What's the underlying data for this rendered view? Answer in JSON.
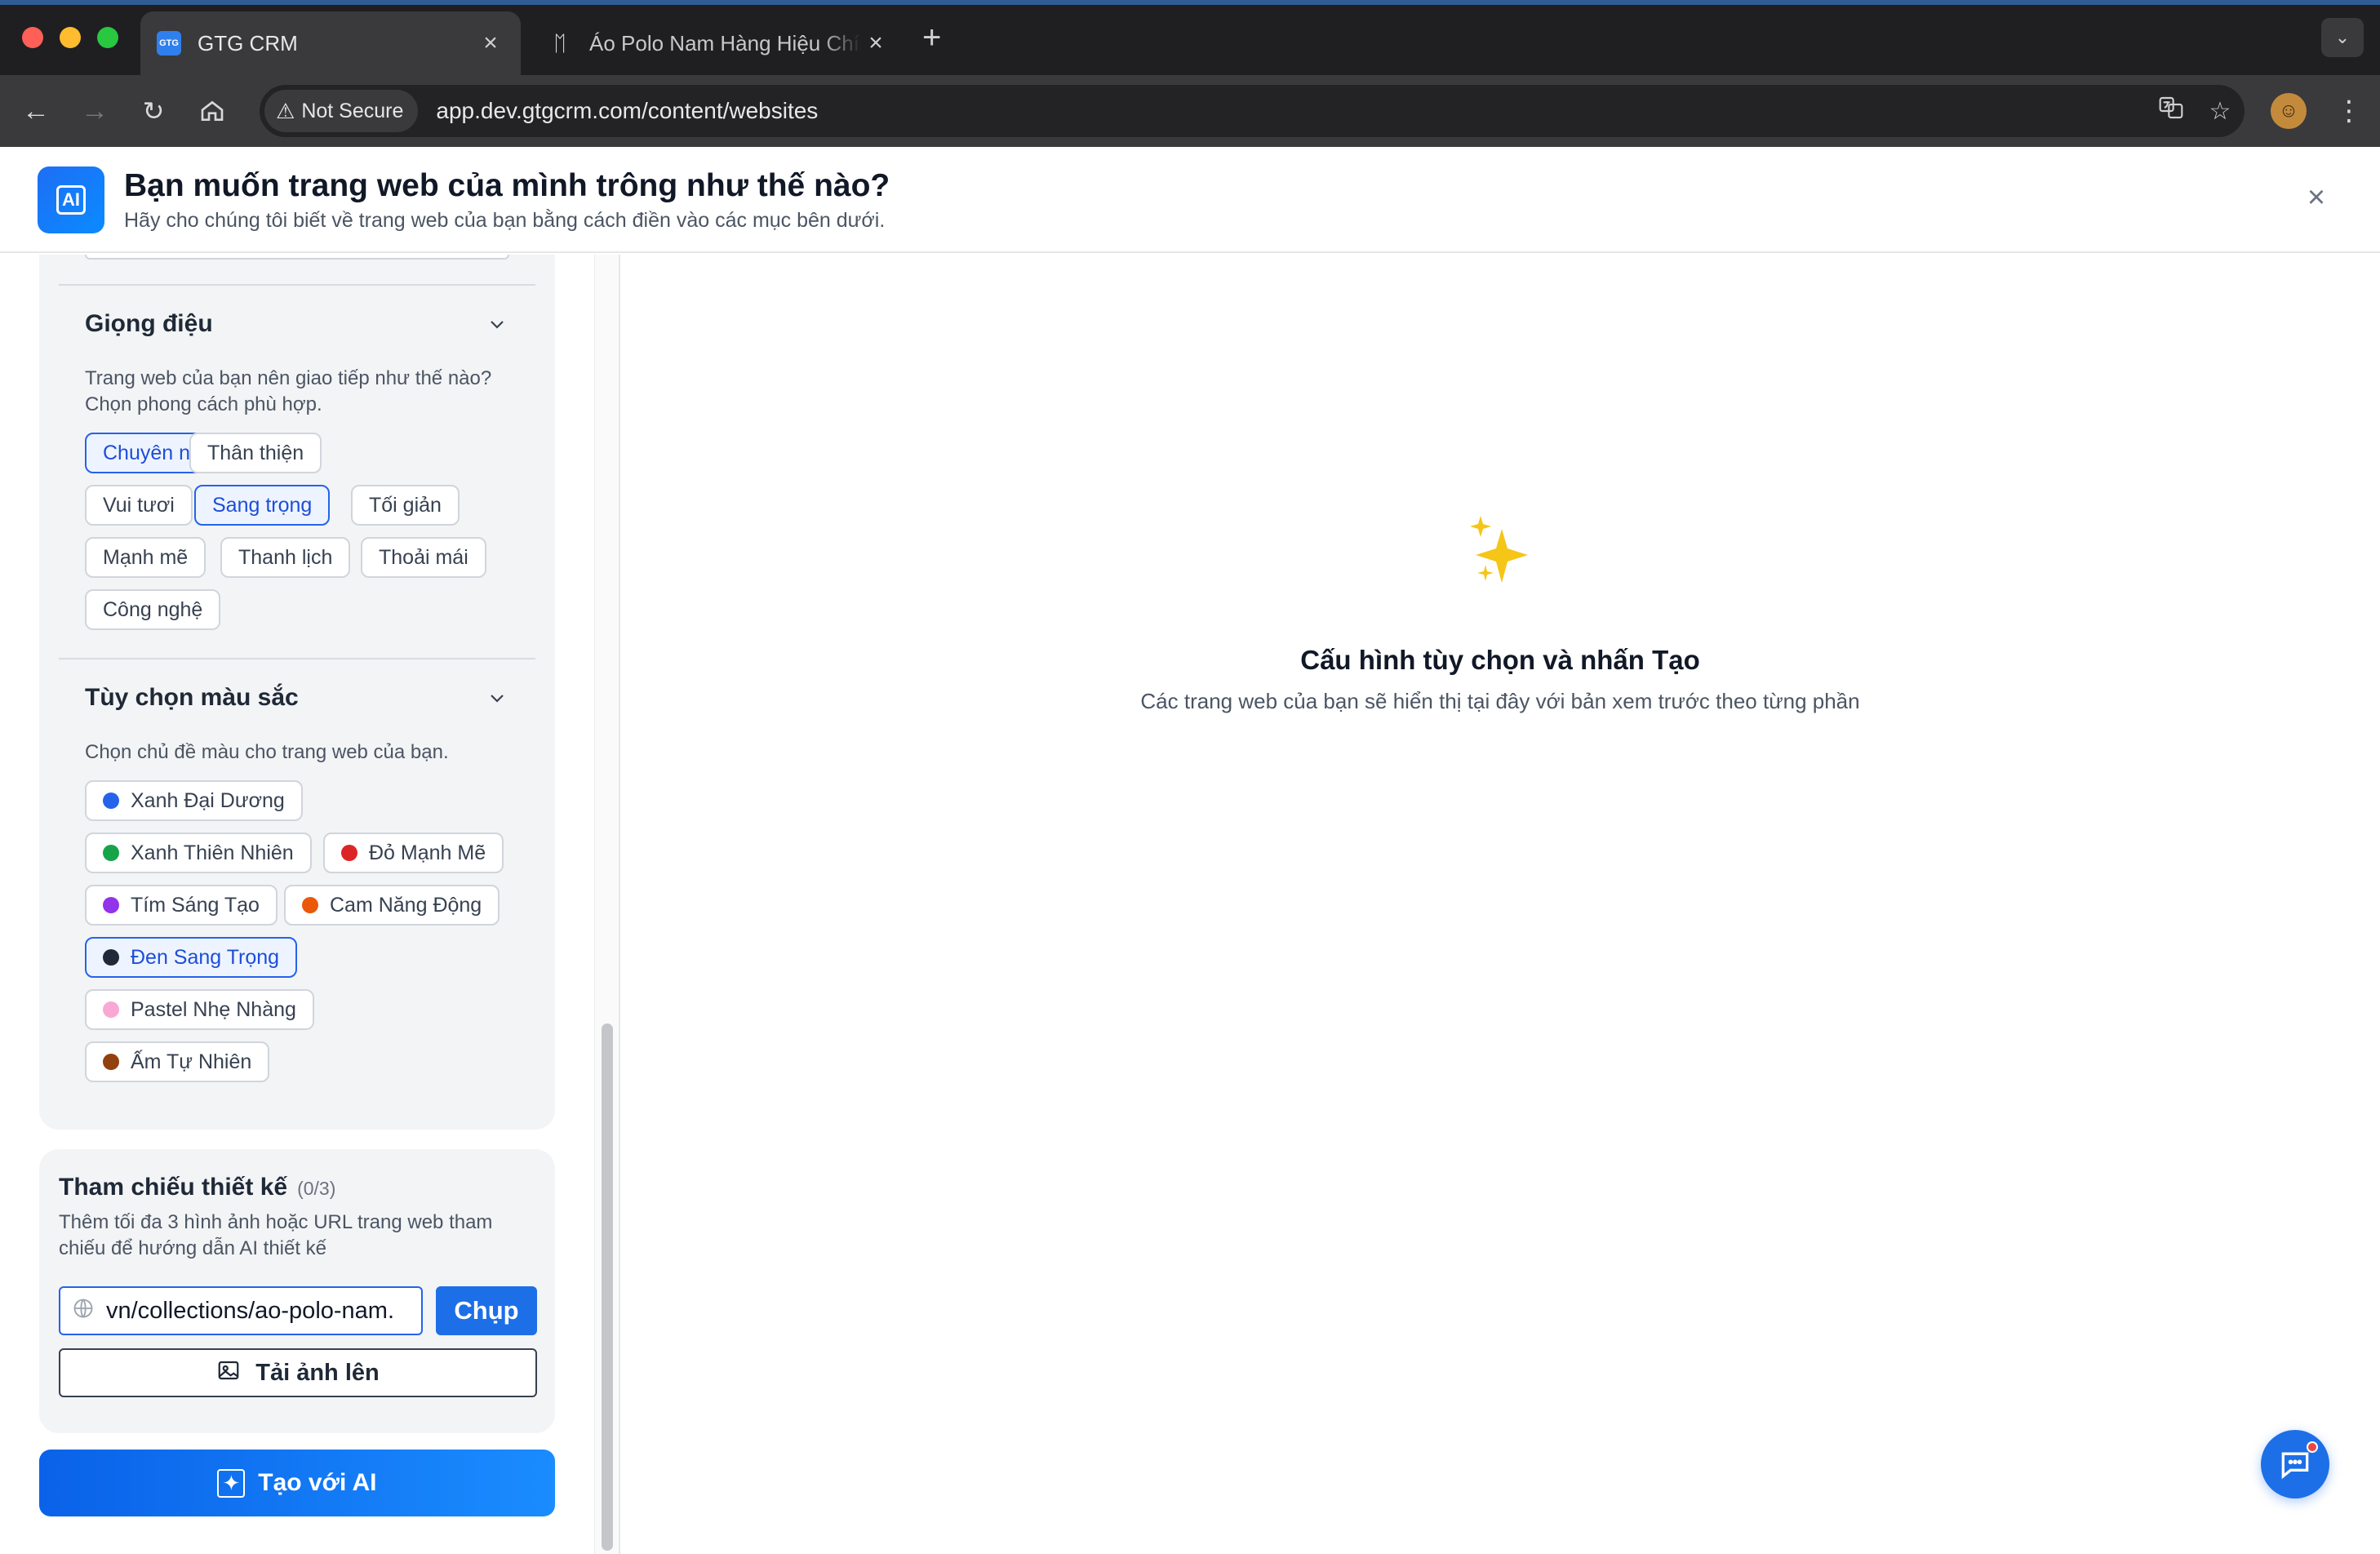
{
  "browser": {
    "tabs": [
      {
        "title": "GTG CRM",
        "favicon": "GTG",
        "active": true
      },
      {
        "title": "Áo Polo Nam Hàng Hiệu Chính",
        "favicon": "brand-logo-icon",
        "active": false
      }
    ],
    "security_label": "Not Secure",
    "url": "app.dev.gtgcrm.com/content/websites"
  },
  "header": {
    "badge": "AI",
    "title": "Bạn muốn trang web của mình trông như thế nào?",
    "subtitle": "Hãy cho chúng tôi biết về trang web của bạn bằng cách điền vào các mục bên dưới."
  },
  "tone": {
    "title": "Giọng điệu",
    "description": "Trang web của bạn nên giao tiếp như thế nào? Chọn phong cách phù hợp.",
    "options": [
      {
        "label": "Chuyên nghiệp",
        "selected": true
      },
      {
        "label": "Thân thiện",
        "selected": false
      },
      {
        "label": "Vui tươi",
        "selected": false
      },
      {
        "label": "Sang trọng",
        "selected": true
      },
      {
        "label": "Tối giản",
        "selected": false
      },
      {
        "label": "Mạnh mẽ",
        "selected": false
      },
      {
        "label": "Thanh lịch",
        "selected": false
      },
      {
        "label": "Thoải mái",
        "selected": false
      },
      {
        "label": "Công nghệ",
        "selected": false
      }
    ]
  },
  "colors": {
    "title": "Tùy chọn màu sắc",
    "description": "Chọn chủ đề màu cho trang web của bạn.",
    "options": [
      {
        "label": "Xanh Đại Dương",
        "color": "#2563eb",
        "selected": false
      },
      {
        "label": "Xanh Thiên Nhiên",
        "color": "#16a34a",
        "selected": false
      },
      {
        "label": "Đỏ Mạnh Mẽ",
        "color": "#dc2626",
        "selected": false
      },
      {
        "label": "Tím Sáng Tạo",
        "color": "#9333ea",
        "selected": false
      },
      {
        "label": "Cam Năng Động",
        "color": "#ea580c",
        "selected": false
      },
      {
        "label": "Đen Sang Trọng",
        "color": "#1f2937",
        "selected": true
      },
      {
        "label": "Pastel Nhẹ Nhàng",
        "color": "#f9a8d4",
        "selected": false
      },
      {
        "label": "Ấm Tự Nhiên",
        "color": "#92400e",
        "selected": false
      }
    ]
  },
  "reference": {
    "title": "Tham chiếu thiết kế",
    "count": "(0/3)",
    "description": "Thêm tối đa 3 hình ảnh hoặc URL trang web tham chiếu để hướng dẫn AI thiết kế",
    "url_value": ".vn/collections/ao-polo-nam",
    "capture_label": "Chụp",
    "upload_label": "Tải ảnh lên"
  },
  "create_label": "Tạo với AI",
  "preview": {
    "title": "Cấu hình tùy chọn và nhấn Tạo",
    "subtitle": "Các trang web của bạn sẽ hiển thị tại đây với bản xem trước theo từng phần"
  }
}
